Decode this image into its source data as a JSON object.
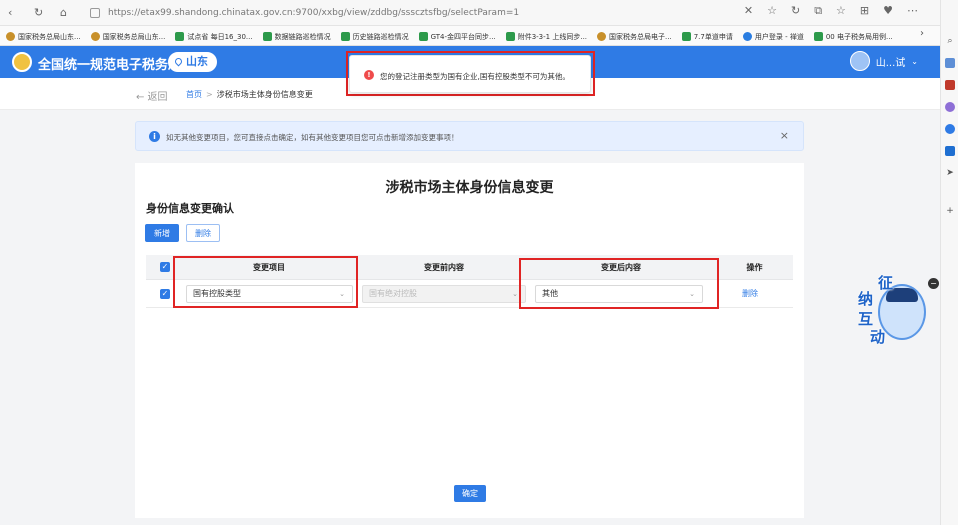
{
  "browser": {
    "url": "https://etax99.shandong.chinatax.gov.cn:9700/xxbg/view/zddbg/ssscztsfbg/selectParam=1",
    "bookmarks": [
      {
        "label": "国家税务总局山东...",
        "icon": "emblem"
      },
      {
        "label": "国家税务总局山东...",
        "icon": "emblem"
      },
      {
        "label": "试点省 每日16_30...",
        "icon": "green"
      },
      {
        "label": "数据链路巡检情况",
        "icon": "green"
      },
      {
        "label": "历史链路巡检情况",
        "icon": "green"
      },
      {
        "label": "GT4-金四平台同步...",
        "icon": "green"
      },
      {
        "label": "附件3-3-1 上线同步...",
        "icon": "green"
      },
      {
        "label": "国家税务总局电子...",
        "icon": "emblem"
      },
      {
        "label": "7.7单道申请",
        "icon": "green"
      },
      {
        "label": "用户登录 - 禅道",
        "icon": "blue"
      },
      {
        "label": "00 电子税务局用例...",
        "icon": "green"
      }
    ]
  },
  "header": {
    "title": "全国统一规范电子税务局",
    "region": "山东",
    "user": "山...试"
  },
  "subnav": {
    "back": "← 返回",
    "home": "首页",
    "separator": ">",
    "current": "涉税市场主体身份信息变更"
  },
  "info": {
    "text": "如无其他变更项目，您可直接点击确定，如有其他变更项目您可点击新增添加变更事项！",
    "close": "×"
  },
  "toast": {
    "message": "您的登记注册类型为国有企业,国有控股类型不可为其他。"
  },
  "card": {
    "title": "涉税市场主体身份信息变更",
    "section_title": "身份信息变更确认",
    "add_label": "新增",
    "delete_label": "删除",
    "confirm_label": "确定"
  },
  "table": {
    "columns": [
      "变更项目",
      "变更前内容",
      "变更后内容",
      "操作"
    ],
    "rows": [
      {
        "item": "国有控股类型",
        "before": "国有绝对控股",
        "after": "其他",
        "action": "删除"
      }
    ]
  },
  "widget": {
    "chars": [
      "征",
      "纳",
      "互",
      "动"
    ],
    "close": "−"
  },
  "colors": {
    "primary": "#2f7be5",
    "highlight": "#e02424",
    "error": "#ef4b4b"
  }
}
